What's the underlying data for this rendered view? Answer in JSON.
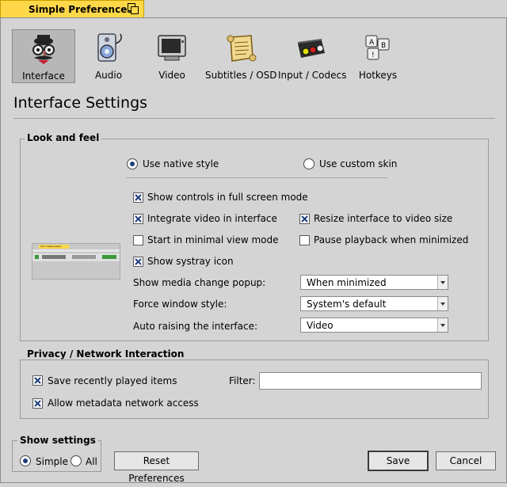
{
  "window": {
    "title": "Simple Preferences"
  },
  "tabs": [
    {
      "label": "Interface",
      "icon": "interface-icon",
      "selected": true
    },
    {
      "label": "Audio",
      "icon": "audio-icon",
      "selected": false
    },
    {
      "label": "Video",
      "icon": "video-icon",
      "selected": false
    },
    {
      "label": "Subtitles / OSD",
      "icon": "subtitles-icon",
      "selected": false
    },
    {
      "label": "Input / Codecs",
      "icon": "input-codecs-icon",
      "selected": false
    },
    {
      "label": "Hotkeys",
      "icon": "hotkeys-icon",
      "selected": false
    }
  ],
  "page_title": "Interface Settings",
  "look_and_feel": {
    "title": "Look and feel",
    "native_style": {
      "label": "Use native style",
      "selected": true
    },
    "custom_skin": {
      "label": "Use custom skin",
      "selected": false
    },
    "preview_caption": "VLC media player",
    "checkboxes": {
      "fullscreen_controls": {
        "label": "Show controls in full screen mode",
        "checked": true
      },
      "integrate_video": {
        "label": "Integrate video in interface",
        "checked": true
      },
      "resize_interface": {
        "label": "Resize interface to video size",
        "checked": true
      },
      "minimal_view": {
        "label": "Start in minimal view mode",
        "checked": false
      },
      "pause_minimized": {
        "label": "Pause playback when minimized",
        "checked": false
      },
      "systray": {
        "label": "Show systray icon",
        "checked": true
      }
    },
    "selects": {
      "media_popup": {
        "label": "Show media change popup:",
        "value": "When minimized"
      },
      "window_style": {
        "label": "Force window style:",
        "value": "System's default"
      },
      "auto_raise": {
        "label": "Auto raising the interface:",
        "value": "Video"
      }
    }
  },
  "privacy": {
    "title": "Privacy / Network Interaction",
    "save_recent": {
      "label": "Save recently played items",
      "checked": true
    },
    "filter_label": "Filter:",
    "filter_value": "",
    "metadata_access": {
      "label": "Allow metadata network access",
      "checked": true
    }
  },
  "show_settings": {
    "title": "Show settings",
    "simple": {
      "label": "Simple",
      "selected": true
    },
    "all": {
      "label": "All",
      "selected": false
    }
  },
  "buttons": {
    "reset": "Reset Preferences",
    "save": "Save",
    "cancel": "Cancel"
  },
  "colors": {
    "titlebar": "#ffd84a",
    "selected_tab": "#b7b7b7",
    "check": "#1e3d7d",
    "background": "#d4d4d4"
  }
}
